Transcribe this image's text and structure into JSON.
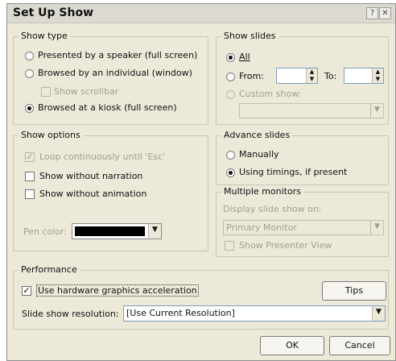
{
  "window": {
    "title": "Set Up Show",
    "help_glyph": "?",
    "close_glyph": "✕"
  },
  "show_type": {
    "label": "Show type",
    "options": [
      {
        "label": "Presented by a speaker (full screen)",
        "selected": false
      },
      {
        "label": "Browsed by an individual (window)",
        "selected": false
      },
      {
        "label": "Browsed at a kiosk (full screen)",
        "selected": true
      }
    ],
    "show_scrollbar": {
      "label": "Show scrollbar",
      "checked": false,
      "enabled": false
    }
  },
  "show_slides": {
    "label": "Show slides",
    "all_label": "All",
    "from_label": "From:",
    "to_label": "To:",
    "from_value": "",
    "to_value": "",
    "custom_label": "Custom show:",
    "custom_value": "",
    "selected": "all"
  },
  "show_options": {
    "label": "Show options",
    "loop": {
      "label": "Loop continuously until 'Esc'",
      "checked": true,
      "enabled": false
    },
    "without_narration": {
      "label": "Show without narration",
      "checked": false
    },
    "without_animation": {
      "label": "Show without animation",
      "checked": false
    },
    "pen_color_label": "Pen color:",
    "pen_color": "#000000"
  },
  "advance_slides": {
    "label": "Advance slides",
    "options": [
      {
        "label": "Manually",
        "selected": false
      },
      {
        "label": "Using timings, if present",
        "selected": true
      }
    ]
  },
  "multiple_monitors": {
    "label": "Multiple monitors",
    "display_on_label": "Display slide show on:",
    "display_value": "Primary Monitor",
    "presenter_view": {
      "label": "Show Presenter View",
      "checked": false,
      "enabled": false
    }
  },
  "performance": {
    "label": "Performance",
    "hardware_accel": {
      "label": "Use hardware graphics acceleration",
      "checked": true
    },
    "tips_label": "Tips",
    "resolution_label": "Slide show resolution:",
    "resolution_value": "[Use Current Resolution]"
  },
  "buttons": {
    "ok": "OK",
    "cancel": "Cancel"
  },
  "glyphs": {
    "check": "✓",
    "arrow_down": "▼",
    "spin_up": "▲",
    "spin_down": "▼"
  }
}
